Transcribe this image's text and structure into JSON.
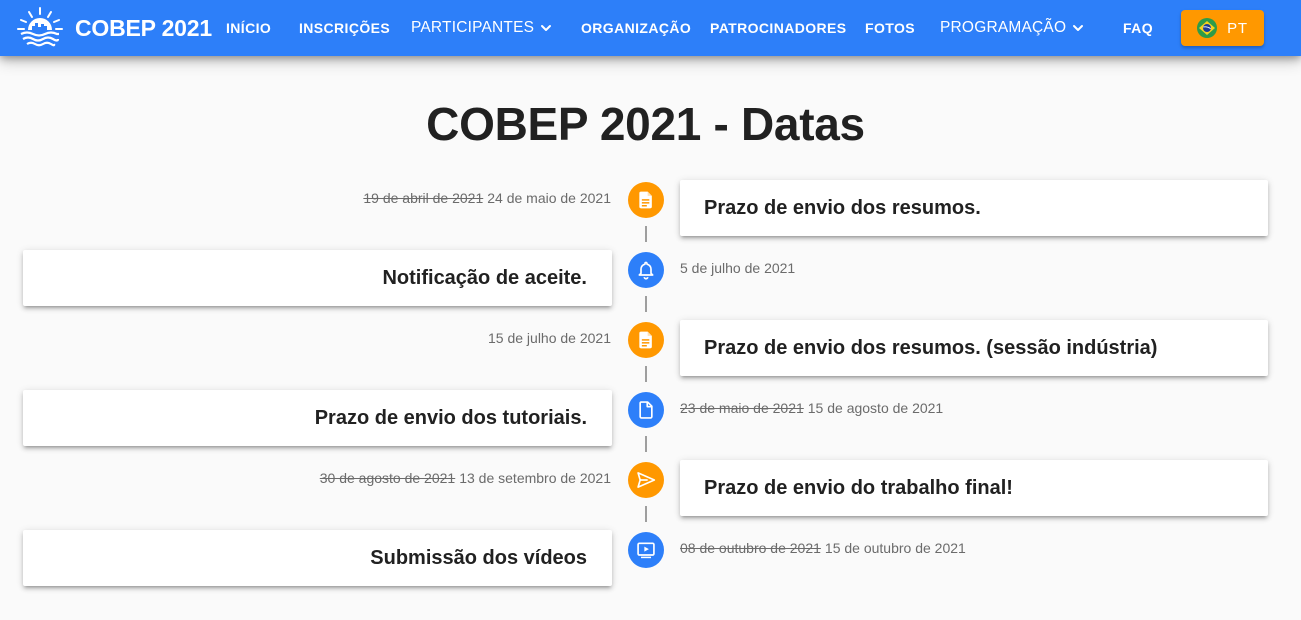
{
  "header": {
    "brand": "COBEP 2021",
    "nav": [
      {
        "label": "INÍCIO"
      },
      {
        "label": "INSCRIÇÕES"
      },
      {
        "label": "PARTICIPANTES"
      },
      {
        "label": "ORGANIZAÇÃO"
      },
      {
        "label": "PATROCINADORES"
      },
      {
        "label": "FOTOS"
      },
      {
        "label": "PROGRAMAÇÃO"
      },
      {
        "label": "FAQ"
      }
    ],
    "language_button": "PT"
  },
  "page_title": "COBEP 2021 - Datas",
  "timeline": [
    {
      "title": "Prazo de envio dos resumos.",
      "old_date": "19 de abril de 2021",
      "date": "24 de maio de 2021",
      "icon": "document-icon",
      "color": "#ff9800"
    },
    {
      "title": "Notificação de aceite.",
      "old_date": "",
      "date": "5 de julho de 2021",
      "icon": "bell-icon",
      "color": "#2d7ff9"
    },
    {
      "title": "Prazo de envio dos resumos. (sessão indústria)",
      "old_date": "",
      "date": "15 de julho de 2021",
      "icon": "document-icon",
      "color": "#ff9800"
    },
    {
      "title": "Prazo de envio dos tutoriais.",
      "old_date": "23 de maio de 2021",
      "date": "15 de agosto de 2021",
      "icon": "file-outline-icon",
      "color": "#2d7ff9"
    },
    {
      "title": "Prazo de envio do trabalho final!",
      "old_date": "30 de agosto de 2021",
      "date": "13 de setembro de 2021",
      "icon": "send-icon",
      "color": "#ff9800"
    },
    {
      "title": "Submissão dos vídeos",
      "old_date": "08 de outubro de 2021",
      "date": "15 de outubro de 2021",
      "icon": "video-icon",
      "color": "#2d7ff9"
    }
  ],
  "colors": {
    "primary": "#2d7ff9",
    "accent": "#ff9800",
    "background": "#fafafa"
  }
}
